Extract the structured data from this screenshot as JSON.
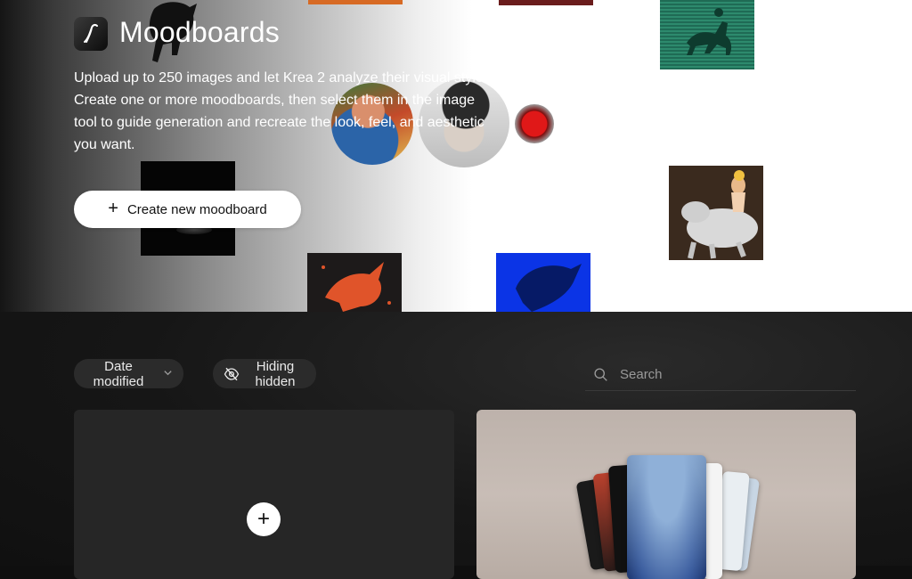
{
  "hero": {
    "title": "Moodboards",
    "description": "Upload up to 250 images and let Krea 2 analyze their visual style. Create one or more moodboards, then select them in the image tool to guide generation and recreate the look, feel, and aesthetic you want.",
    "create_button_label": "Create new moodboard",
    "create_button_icon": "plus-icon"
  },
  "controls": {
    "sort_label": "Date modified",
    "sort_icon": "chevron-down-icon",
    "visibility_label": "Hiding hidden",
    "visibility_icon": "eye-off-icon",
    "search_placeholder": "Search",
    "search_icon": "search-icon"
  },
  "cards": {
    "new_card_icon": "plus-icon",
    "new_card_symbol": "+"
  },
  "colors": {
    "accent_button_bg": "#ffffff",
    "chip_bg": "#2b2b2b",
    "card_bg": "#262626",
    "page_bg": "#101010"
  }
}
